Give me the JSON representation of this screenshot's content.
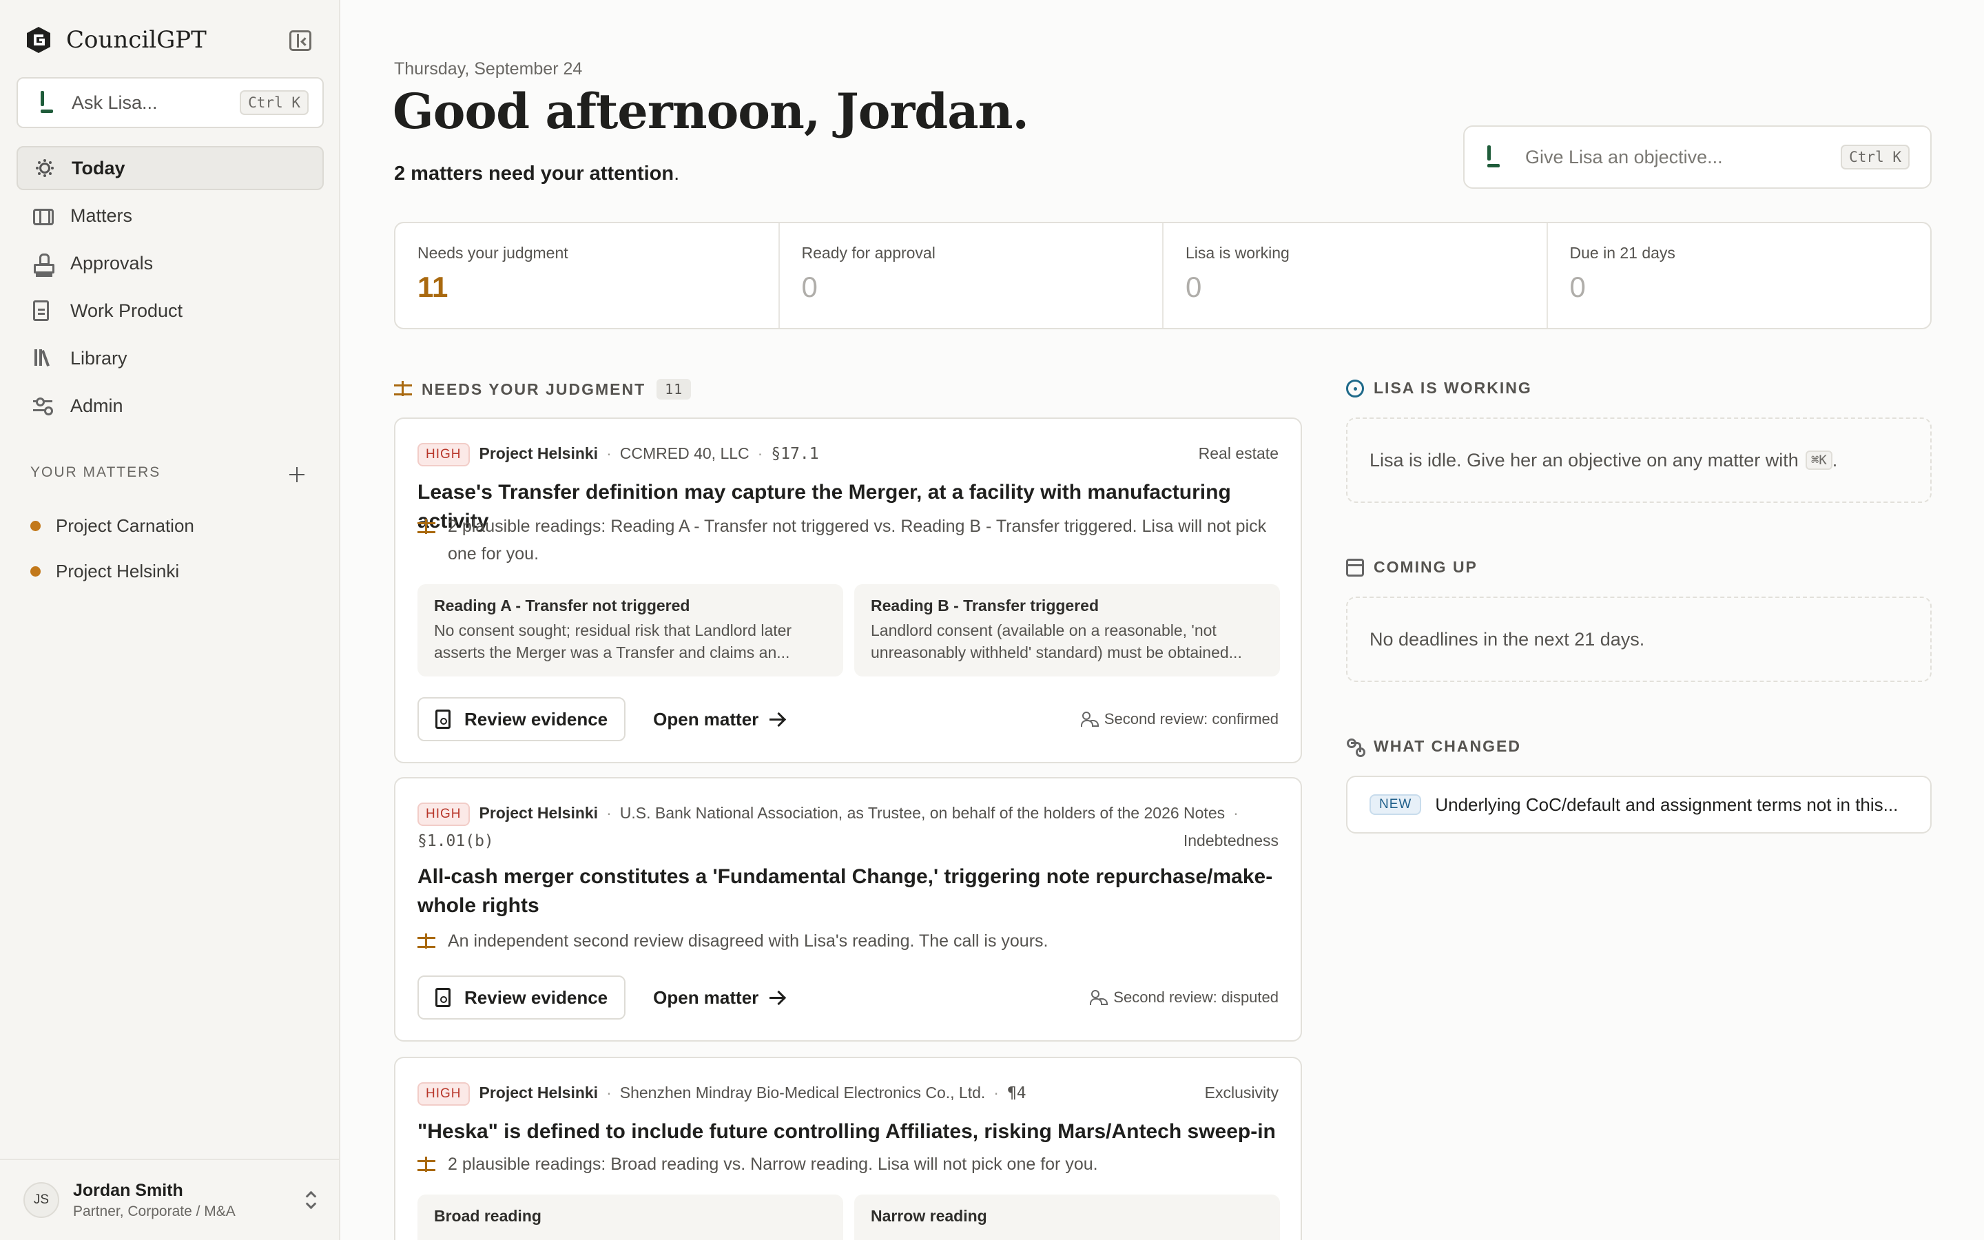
{
  "app": {
    "name": "CouncilGPT"
  },
  "sidebar": {
    "ask_placeholder": "Ask Lisa...",
    "ask_shortcut": "Ctrl K",
    "nav": [
      {
        "label": "Today",
        "icon": "sun-icon",
        "active": true
      },
      {
        "label": "Matters",
        "icon": "briefcase-icon"
      },
      {
        "label": "Approvals",
        "icon": "stamp-icon"
      },
      {
        "label": "Work Product",
        "icon": "document-icon"
      },
      {
        "label": "Library",
        "icon": "library-icon"
      },
      {
        "label": "Admin",
        "icon": "sliders-icon"
      }
    ],
    "matters_heading": "YOUR MATTERS",
    "matters": [
      {
        "label": "Project Carnation"
      },
      {
        "label": "Project Helsinki"
      }
    ],
    "user": {
      "initials": "JS",
      "name": "Jordan Smith",
      "role": "Partner, Corporate / M&A"
    }
  },
  "header": {
    "date": "Thursday, September 24",
    "greeting": "Good afternoon, Jordan.",
    "attention": "2 matters need your attention",
    "objective_placeholder": "Give Lisa an objective...",
    "objective_shortcut": "Ctrl K"
  },
  "stats": [
    {
      "label": "Needs your judgment",
      "value": "11"
    },
    {
      "label": "Ready for approval",
      "value": "0"
    },
    {
      "label": "Lisa is working",
      "value": "0"
    },
    {
      "label": "Due in 21 days",
      "value": "0"
    }
  ],
  "judgment": {
    "heading": "NEEDS YOUR JUDGMENT",
    "count": "11",
    "cards": [
      {
        "priority": "HIGH",
        "project": "Project Helsinki",
        "party": "CCMRED 40, LLC",
        "section": "§17.1",
        "category": "Real estate",
        "title": "Lease's Transfer definition may capture the Merger, at a facility with manufacturing activity",
        "description": "2 plausible readings: Reading A - Transfer not triggered vs. Reading B - Transfer triggered. Lisa will not pick one for you.",
        "readings": [
          {
            "title": "Reading A - Transfer not triggered",
            "body": "No consent sought; residual risk that Landlord later asserts the Merger was a Transfer and claims an..."
          },
          {
            "title": "Reading B - Transfer triggered",
            "body": "Landlord consent (available on a reasonable, 'not unreasonably withheld' standard) must be obtained..."
          }
        ],
        "review_button": "Review evidence",
        "open_link": "Open matter",
        "second_review": "Second review: confirmed"
      },
      {
        "priority": "HIGH",
        "project": "Project Helsinki",
        "party": "U.S. Bank National Association, as Trustee, on behalf of the holders of the 2026 Notes",
        "section": "§1.01(b)",
        "category": "Indebtedness",
        "title": "All-cash merger constitutes a 'Fundamental Change,' triggering note repurchase/make-whole rights",
        "description": "An independent second review disagreed with Lisa's reading. The call is yours.",
        "review_button": "Review evidence",
        "open_link": "Open matter",
        "second_review": "Second review: disputed"
      },
      {
        "priority": "HIGH",
        "project": "Project Helsinki",
        "party": "Shenzhen Mindray Bio-Medical Electronics Co., Ltd.",
        "section": "¶4",
        "category": "Exclusivity",
        "title": "\"Heska\" is defined to include future controlling Affiliates, risking Mars/Antech sweep-in",
        "description": "2 plausible readings: Broad reading vs. Narrow reading. Lisa will not pick one for you.",
        "readings": [
          {
            "title": "Broad reading",
            "body": ""
          },
          {
            "title": "Narrow reading",
            "body": ""
          }
        ]
      }
    ]
  },
  "working": {
    "heading": "LISA IS WORKING",
    "idle_text": "Lisa is idle. Give her an objective on any matter with",
    "shortcut": "⌘K",
    "suffix": "."
  },
  "coming_up": {
    "heading": "COMING UP",
    "text": "No deadlines in the next 21 days."
  },
  "what_changed": {
    "heading": "WHAT CHANGED",
    "badge": "NEW",
    "text": "Underlying CoC/default and assignment terms not in this..."
  }
}
